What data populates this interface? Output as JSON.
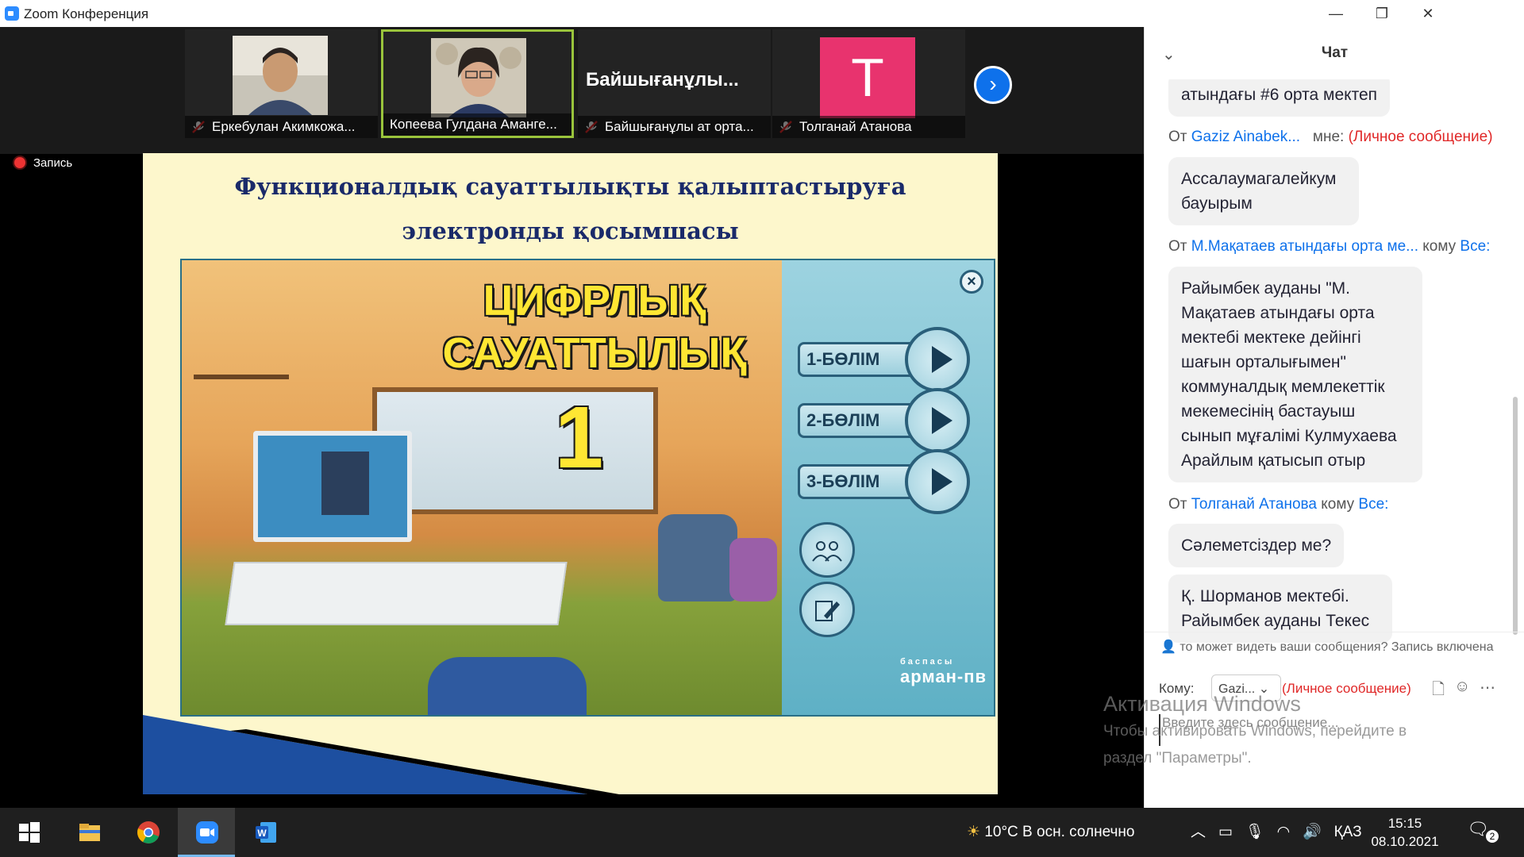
{
  "window": {
    "title": "Zoom Конференция"
  },
  "window_controls": {
    "minimize": "—",
    "restore": "❐",
    "close": "✕"
  },
  "participants": [
    {
      "name": "Еркебулан Акимкожа...",
      "muted": true,
      "type": "video"
    },
    {
      "name": "Копеева Гулдана Аманге...",
      "muted": false,
      "type": "video",
      "active": true
    },
    {
      "name": "Байшығанұлы ат орта...",
      "display_name": "Байшығанұлы...",
      "muted": true,
      "type": "name"
    },
    {
      "name": "Толганай Атанова",
      "avatar_letter": "T",
      "muted": true,
      "type": "avatar",
      "avatar_color": "#e8336e"
    }
  ],
  "recording": {
    "label": "Запись"
  },
  "slide": {
    "heading_lines": [
      "Функционалдық сауаттылықты қалыптастыруға",
      "электронды қосымшасы"
    ],
    "game": {
      "title_line1": "ЦИФРЛЫҚ",
      "title_line2": "САУАТТЫЛЫҚ",
      "number": "1",
      "sections": [
        "1-БӨЛІМ",
        "2-БӨЛІМ",
        "3-БӨЛІМ"
      ],
      "brand": "арман-пв",
      "brand_small": "баспасы",
      "close_symbol": "×",
      "participants_icon": "group-icon",
      "edit_icon": "edit-icon"
    }
  },
  "chat": {
    "title": "Чат",
    "messages": [
      {
        "kind": "bubble",
        "text": "атындағы #6 орта мектеп"
      },
      {
        "kind": "header",
        "prefix": "От",
        "sender": "Gaziz Ainabek...",
        "to_word": "мне:",
        "private": "(Личное сообщение)"
      },
      {
        "kind": "bubble",
        "text": "Ассалаумагалейкум\nбауырым"
      },
      {
        "kind": "header",
        "prefix": "От",
        "sender": "М.Мақатаев атындағы орта ме...",
        "to_word": "кому",
        "to_target": "Все:"
      },
      {
        "kind": "bubble",
        "text": "Райымбек ауданы \"М. Мақатаев атындағы орта мектебі мектеке дейінгі шағын орталығымен\" коммуналдық мемлекеттік мекемесінің бастауыш сынып мұғалімі Кулмухаева Арайлым қатысып отыр"
      },
      {
        "kind": "header",
        "prefix": "От",
        "sender": "Толганай Атанова",
        "to_word": "кому",
        "to_target": "Все:"
      },
      {
        "kind": "bubble",
        "text": "Сәлеметсіздер ме?"
      },
      {
        "kind": "bubble",
        "text": "Қ. Шорманов мектебі. Райымбек ауданы Текес"
      }
    ],
    "notice": "то может видеть ваши сообщения? Запись включена",
    "to_label": "Кому:",
    "to_value": "Gazi...",
    "to_private": "(Личное сообщение)",
    "placeholder": "Введите здесь сообщение..."
  },
  "activation": {
    "title": "Активация Windows",
    "line1": "Чтобы активировать Windows, перейдите в",
    "line2": "раздел \"Параметры\"."
  },
  "taskbar": {
    "weather": "10°C  В осн. солнечно",
    "language": "ҚАЗ",
    "time": "15:15",
    "date": "08.10.2021",
    "notifications": "2"
  }
}
